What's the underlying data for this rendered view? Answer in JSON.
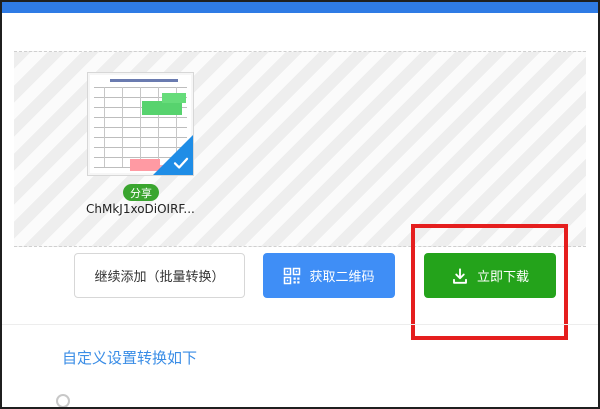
{
  "upload": {
    "file": {
      "name": "ChMkJ1xoDiOIRF...",
      "share_label": "分享",
      "selected": true
    }
  },
  "actions": {
    "continue_label": "继续添加（批量转换）",
    "qr_label": "获取二维码",
    "download_label": "立即下载"
  },
  "settings": {
    "link_label": "自定义设置转换如下"
  },
  "colors": {
    "topbar": "#2F7BE5",
    "qr_button": "#3F8EF6",
    "download_button": "#24A31B",
    "highlight": "#E51E1E",
    "link": "#3A8DE6",
    "share_badge": "#3AA52F"
  },
  "icons": {
    "qr": "qr-code-icon",
    "download": "download-icon",
    "selected": "check-icon"
  }
}
